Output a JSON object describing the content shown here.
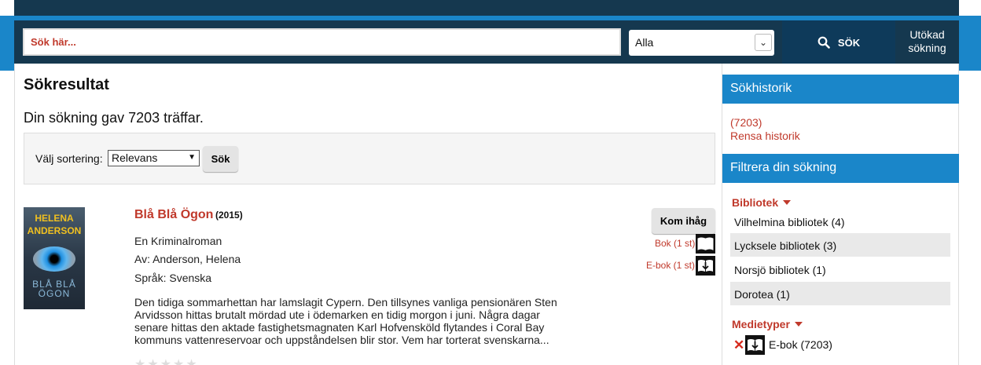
{
  "search": {
    "placeholder": "Sök här...",
    "scope": "Alla",
    "button_label": "SÖK",
    "advanced_label": "Utökad sökning"
  },
  "results": {
    "title": "Sökresultat",
    "count_text": "Din sökning gav 7203 träffar.",
    "sort_label": "Välj sortering:",
    "sort_value": "Relevans",
    "sort_button": "Sök"
  },
  "book": {
    "cover_author": "HELENA ANDERSON",
    "cover_title": "BLÅ BLÅ ÖGON",
    "title": "Blå Blå Ögon",
    "year": "(2015)",
    "subtitle": "En Kriminalroman",
    "author": "Av: Anderson, Helena",
    "language": "Språk: Svenska",
    "description": "Den tidiga sommarhettan har lamslagit Cypern. Den tillsynes vanliga pensionären Sten Arvidsson hittas brutalt mördad ute i ödemarken en tidig morgon i juni. Några dagar senare hittas den aktade fastighetsmagnaten Karl Hofvensköld flytandes i Coral Bay kommuns vattenreservoar och uppståndelsen blir stor. Vem har torterat svenskarna...",
    "remember_label": "Kom ihåg",
    "availability": [
      {
        "label": "Bok (1 st)",
        "icon": "book-icon"
      },
      {
        "label": "E-bok (1 st)",
        "icon": "ebook-download-icon"
      }
    ],
    "rating_stars": 0
  },
  "sidebar": {
    "history_title": "Sökhistorik",
    "history_item": "(7203)",
    "clear_history": "Rensa historik",
    "filter_title": "Filtrera din sökning",
    "library_facet": "Bibliotek",
    "libraries": [
      "Vilhelmina bibliotek (4)",
      "Lycksele bibliotek (3)",
      "Norsjö bibliotek (1)",
      "Dorotea (1)"
    ],
    "media_facet": "Medietyper",
    "media_item": "E-bok (7203)"
  },
  "colors": {
    "accent": "#c0392b",
    "nav": "#15384f",
    "blue": "#1a86c9"
  }
}
